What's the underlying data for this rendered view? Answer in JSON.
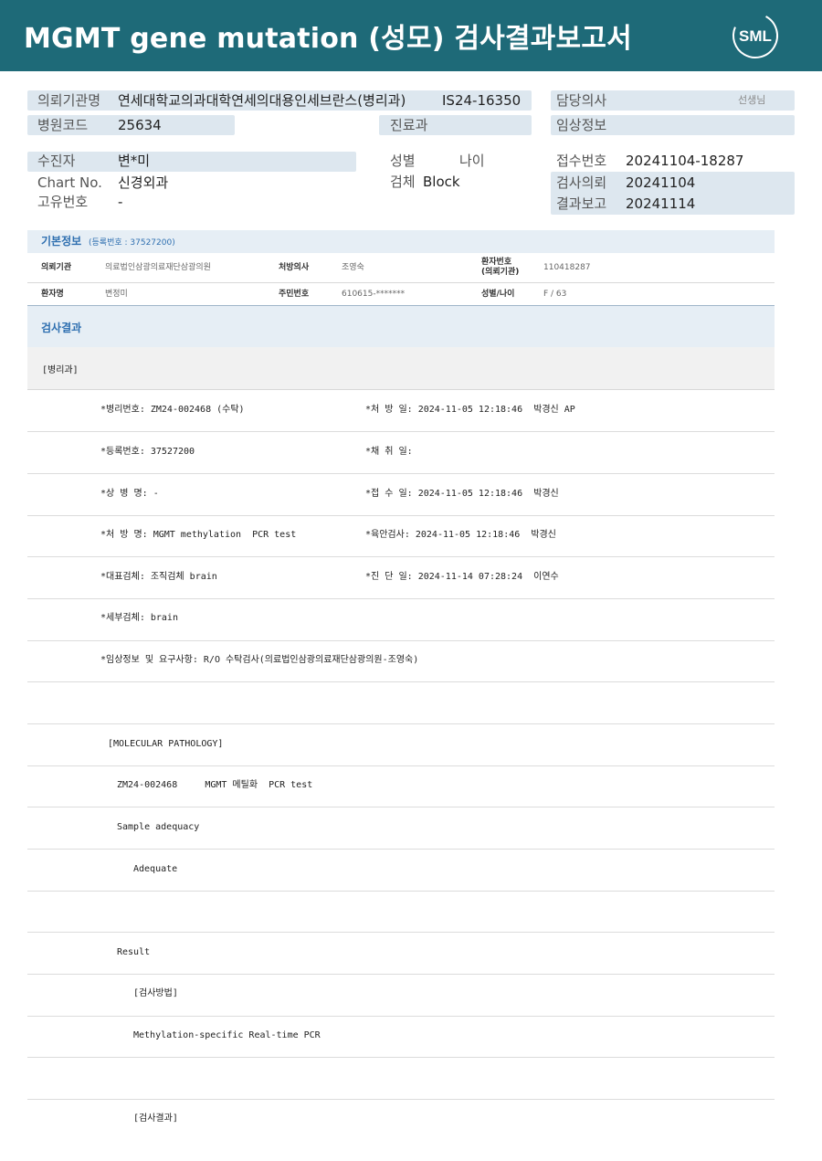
{
  "header": {
    "title": "MGMT gene mutation (성모) 검사결과보고서",
    "logo_text": "SML"
  },
  "meta": {
    "requester_label": "의뢰기관명",
    "requester_value": "연세대학교의과대학연세의대용인세브란스(병리과)",
    "requester_code_label": "병원코드",
    "requester_code_value": "25634",
    "specimen_no": "IS24-16350",
    "doctor_label": "담당의사",
    "doctor_suffix": "선생님",
    "dept_label": "진료과",
    "clinical_label": "임상정보",
    "patient_label": "수진자",
    "patient_value": "변*미",
    "chart_label": "Chart No.",
    "chart_value": "신경외과",
    "unique_label": "고유번호",
    "unique_value": "-",
    "sex_label": "성별",
    "age_label": "나이",
    "specimen_label": "검체",
    "specimen_value": "Block",
    "receipt_label": "접수번호",
    "receipt_value": "20241104-18287",
    "request_label": "검사의뢰",
    "request_value": "20241104",
    "report_label": "결과보고",
    "report_value": "20241114"
  },
  "basic_info": {
    "title": "기본정보",
    "reg": "(등록번호 : 37527200)",
    "rows": [
      {
        "k1": "의뢰기관",
        "v1": "의료법인삼광의료재단삼광의원",
        "k2": "처방의사",
        "v2": "조영숙",
        "k3a": "환자번호",
        "k3b": "(의뢰기관)",
        "v3": "110418287"
      },
      {
        "k1": "환자명",
        "v1": "변정미",
        "k2": "주민번호",
        "v2": "610615-*******",
        "k3a": "성별/나이",
        "k3b": "",
        "v3": "F / 63"
      }
    ]
  },
  "results": {
    "title": "검사결과",
    "section": "[병리과]",
    "rows": [
      {
        "left": "*병리번호: ZM24-002468 (수탁)",
        "right": "*처 방 일: 2024-11-05 12:18:46  박경신 AP"
      },
      {
        "left": "*등록번호: 37527200",
        "right": "*채 취 일:"
      },
      {
        "left": "*상 병 명: -",
        "right": "*접 수 일: 2024-11-05 12:18:46  박경신"
      },
      {
        "left": "*처 방 명: MGMT methylation  PCR test",
        "right": "*육안검사: 2024-11-05 12:18:46  박경신"
      },
      {
        "left": "*대표검체: 조직검체 brain",
        "right": "*진 단 일: 2024-11-14 07:28:24  이연수"
      },
      {
        "left": "*세부검체: brain",
        "right": ""
      },
      {
        "left": "*임상정보 및 요구사항: R/O 수탁검사(의료법인삼광의료재단삼광의원-조영숙)",
        "right": ""
      }
    ],
    "body_lines": [
      "[MOLECULAR PATHOLOGY]",
      "ZM24-002468     MGMT 메틸화  PCR test",
      "Sample adequacy",
      "Adequate",
      "Result",
      "[검사방법]",
      "Methylation-specific Real-time PCR",
      "[검사결과]"
    ]
  }
}
